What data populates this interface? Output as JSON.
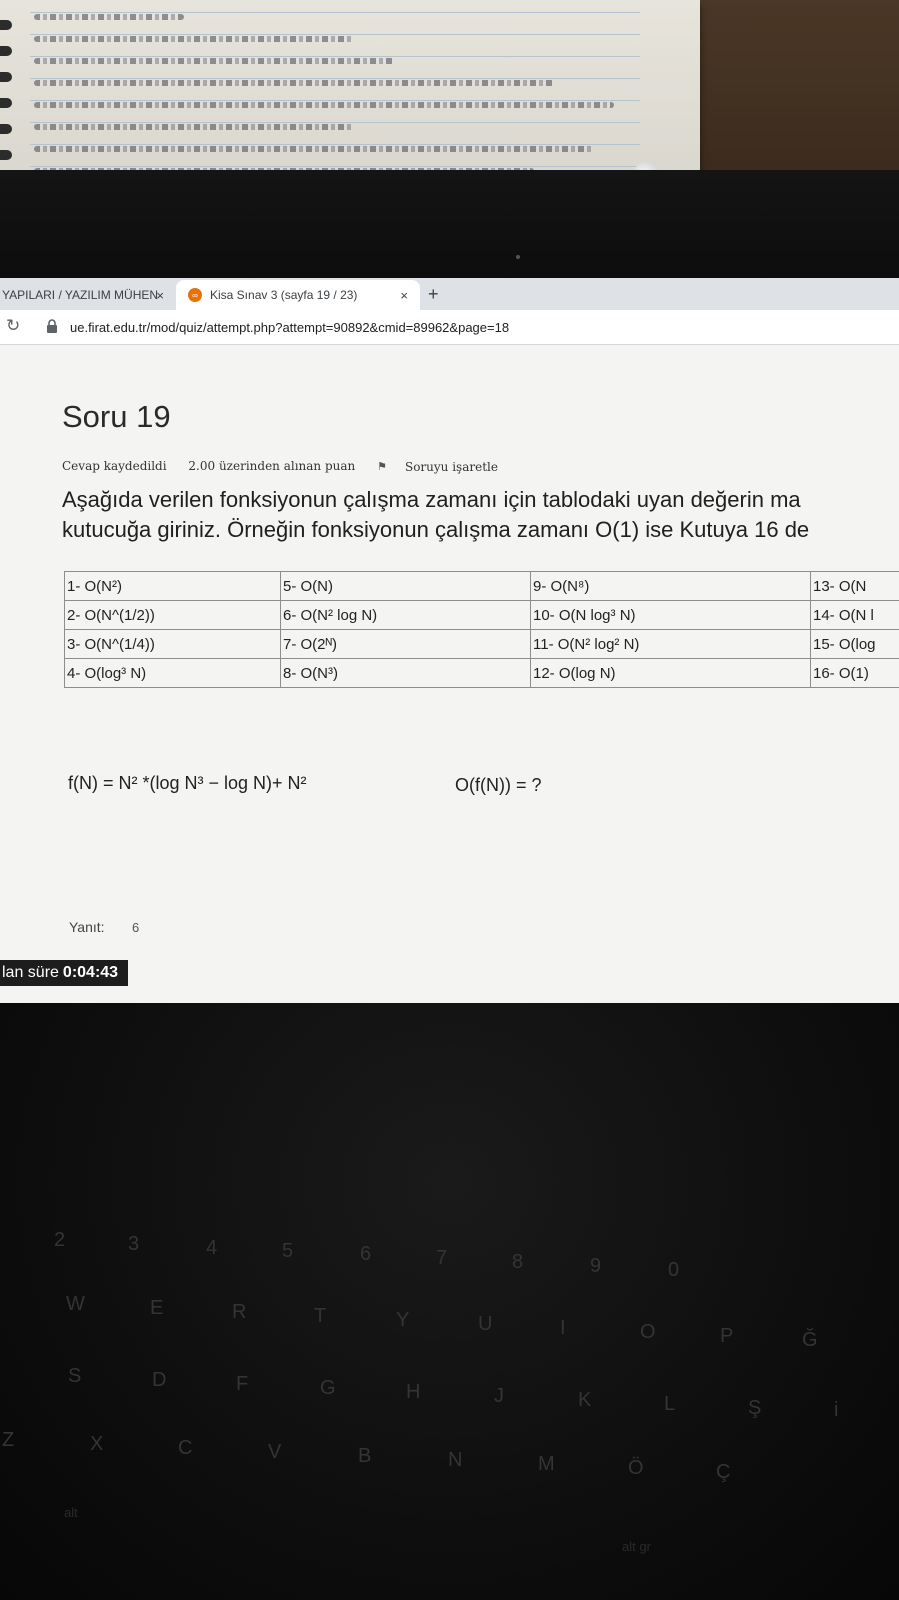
{
  "browser": {
    "tabs": [
      {
        "label": "YAPILARI / YAZILIM MÜHEN",
        "close": "×"
      },
      {
        "label": "Kisa Sınav 3 (sayfa 19 / 23)",
        "close": "×"
      }
    ],
    "new_tab": "+",
    "url": "ue.firat.edu.tr/mod/quiz/attempt.php?attempt=90892&cmid=89962&page=18"
  },
  "question": {
    "title": "Soru 19",
    "status": "Cevap kaydedildi",
    "points": "2.00 üzerinden alınan puan",
    "flag": "Soruyu işaretle",
    "text_line1": "Aşağıda verilen fonksiyonun çalışma zamanı için tablodaki uyan değerin ma",
    "text_line2": "kutucuğa giriniz. Örneğin fonksiyonun çalışma zamanı O(1) ise Kutuya 16 de",
    "table": [
      [
        "1- O(N²)",
        "5- O(N)",
        "9- O(N⁸)",
        "13- O(N"
      ],
      [
        "2- O(N^(1/2))",
        "6- O(N² log N)",
        "10- O(N log³ N)",
        "14- O(N l"
      ],
      [
        "3- O(N^(1/4))",
        "7- O(2ᴺ)",
        "11- O(N² log² N)",
        "15- O(log"
      ],
      [
        "4- O(log³ N)",
        "8- O(N³)",
        "12- O(log N)",
        "16- O(1)"
      ]
    ],
    "formula": "f(N) = N² *(log N³ − log N)+ N²",
    "big_o": "O(f(N)) = ?",
    "answer_label": "Yanıt:",
    "answer_value": "6"
  },
  "timer": {
    "label": "lan süre",
    "value": "0:04:43"
  },
  "keyboard": {
    "row_numbers": [
      "2",
      "3",
      "4",
      "5",
      "6",
      "7",
      "8",
      "9",
      "0"
    ],
    "row_q": [
      "W",
      "E",
      "R",
      "T",
      "Y",
      "U",
      "I",
      "O",
      "P",
      "Ğ"
    ],
    "row_a": [
      "S",
      "D",
      "F",
      "G",
      "H",
      "J",
      "K",
      "L",
      "Ş",
      "i"
    ],
    "row_z": [
      "Z",
      "X",
      "C",
      "V",
      "B",
      "N",
      "M",
      "Ö",
      "Ç"
    ],
    "alt": "alt",
    "alt_gr": "alt gr"
  }
}
